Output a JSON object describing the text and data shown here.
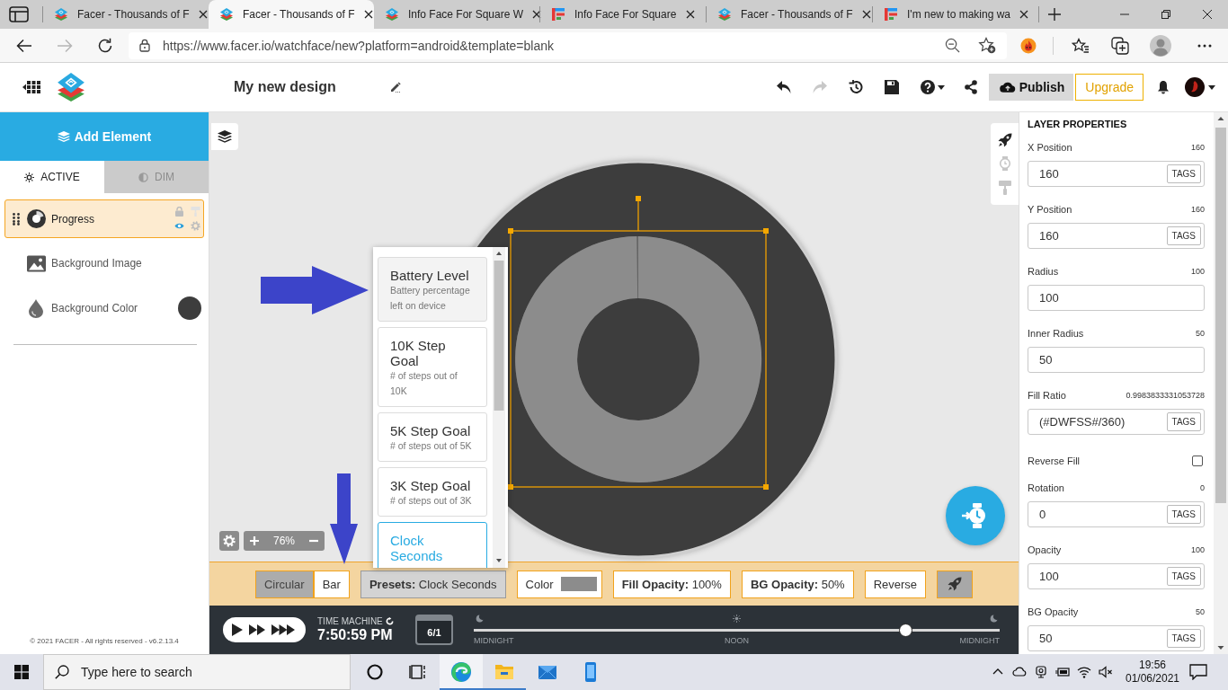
{
  "browser": {
    "tabs": [
      {
        "title": "Facer - Thousands of F",
        "kind": "cube",
        "selected": false
      },
      {
        "title": "Facer - Thousands of F",
        "kind": "cube",
        "selected": true
      },
      {
        "title": "Info Face For Square W",
        "kind": "cube",
        "selected": false
      },
      {
        "title": "Info Face For Square",
        "kind": "letter",
        "selected": false
      },
      {
        "title": "Facer - Thousands of F",
        "kind": "cube",
        "selected": false
      },
      {
        "title": "I'm new to making wa",
        "kind": "letter",
        "selected": false
      }
    ],
    "address": "https://www.facer.io/watchface/new?platform=android&template=blank"
  },
  "header": {
    "title": "My new design",
    "publish": "Publish",
    "upgrade": "Upgrade"
  },
  "left_panel": {
    "add_element": "Add Element",
    "modes": [
      {
        "label": "ACTIVE",
        "kind": "sun",
        "selected": true
      },
      {
        "label": "DIM",
        "kind": "half",
        "selected": false
      }
    ],
    "layers": [
      {
        "label": "Progress",
        "kind": "progress",
        "selected": true
      },
      {
        "label": "Background Image",
        "kind": "image",
        "selected": false
      },
      {
        "label": "Background Color",
        "kind": "color",
        "selected": false,
        "color": "#3d3d3d"
      }
    ],
    "footer": "© 2021 FACER - All rights reserved - v6.2.13.4"
  },
  "canvas": {
    "zoom": "76%",
    "progress": {
      "level": 0.998
    },
    "presets": [
      {
        "title": "Battery Level",
        "description": "Battery percentage left on device",
        "highlighted": true,
        "selected": false
      },
      {
        "title": "10K Step Goal",
        "description": "# of steps out of 10K",
        "highlighted": false,
        "selected": false
      },
      {
        "title": "5K Step Goal",
        "description": "# of steps out of 5K",
        "highlighted": false,
        "selected": false
      },
      {
        "title": "3K Step Goal",
        "description": "# of steps out of 3K",
        "highlighted": false,
        "selected": false
      },
      {
        "title": "Clock Seconds",
        "highlighted": false,
        "selected": true
      }
    ]
  },
  "toolbar": {
    "shapes": [
      {
        "label": "Circular",
        "selected": true
      },
      {
        "label": "Bar",
        "selected": false
      }
    ],
    "presets": {
      "text": "**Presets:** Clock Seconds",
      "expanded": true
    },
    "color": {
      "label": "Color",
      "color": "#8c8c8c"
    },
    "fill_opacity": "**Fill Opacity:** 100%",
    "bg_opacity": "**BG Opacity:** 50%",
    "reverse": "Reverse"
  },
  "time_machine": {
    "label": "TIME MACHINE",
    "time": "7:50:59 PM",
    "date": "6/1",
    "level": 0.82,
    "ticks": [
      {
        "label": "MIDNIGHT",
        "kind": "night"
      },
      {
        "label": "NOON",
        "kind": "day"
      },
      {
        "label": "MIDNIGHT",
        "kind": "night"
      }
    ]
  },
  "properties": {
    "title": "LAYER PROPERTIES",
    "fields": [
      {
        "kind": "input",
        "label": "X Position",
        "reading": "160",
        "value": "160",
        "tags": "TAGS"
      },
      {
        "kind": "input",
        "label": "Y Position",
        "reading": "160",
        "value": "160",
        "tags": "TAGS"
      },
      {
        "kind": "input",
        "label": "Radius",
        "reading": "100",
        "value": "100"
      },
      {
        "kind": "input",
        "label": "Inner Radius",
        "reading": "50",
        "value": "50"
      },
      {
        "kind": "input",
        "label": "Fill Ratio",
        "reading": "0.9983833331053728",
        "value": "(#DWFSS#/360)",
        "tags": "TAGS"
      },
      {
        "kind": "checkbox",
        "label": "Reverse Fill",
        "checked": false
      },
      {
        "kind": "input",
        "label": "Rotation",
        "reading": "0",
        "value": "0",
        "tags": "TAGS"
      },
      {
        "kind": "input",
        "label": "Opacity",
        "reading": "100",
        "value": "100",
        "tags": "TAGS"
      },
      {
        "kind": "input",
        "label": "BG Opacity",
        "reading": "50",
        "value": "50",
        "tags": "TAGS"
      }
    ]
  },
  "taskbar": {
    "search": {
      "placeholder": "Type here to search"
    },
    "apps": [
      {
        "kind": "cortana",
        "running": false,
        "selected": false
      },
      {
        "kind": "taskview",
        "running": false,
        "selected": false
      },
      {
        "kind": "edge",
        "running": true,
        "selected": true
      },
      {
        "kind": "explorer",
        "running": true,
        "selected": false
      },
      {
        "kind": "mail",
        "running": false,
        "selected": false
      },
      {
        "kind": "phone",
        "running": false,
        "selected": false
      }
    ],
    "time": "19:56",
    "date": "01/06/2021"
  }
}
